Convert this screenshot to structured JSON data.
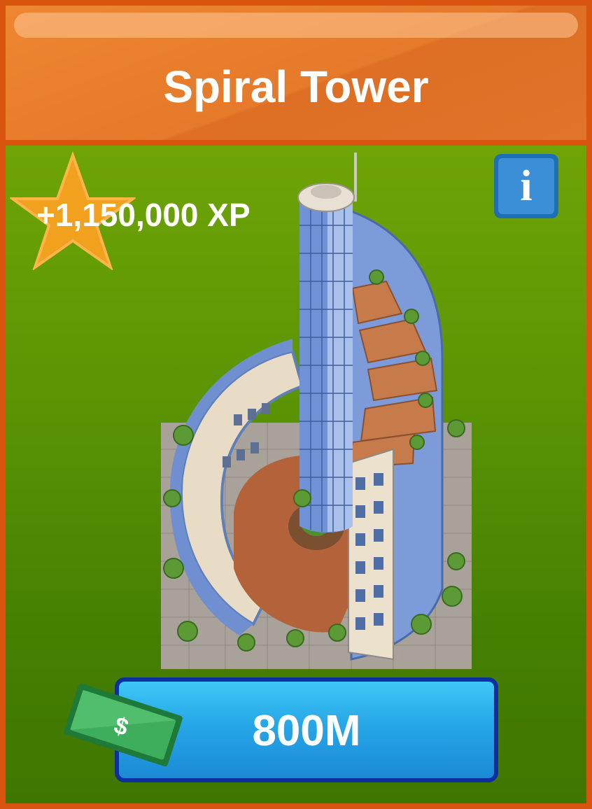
{
  "header": {
    "title": "Spiral Tower"
  },
  "reward": {
    "xp_label": "+1,150,000 XP"
  },
  "info": {
    "glyph": "i"
  },
  "price": {
    "label": "800M",
    "currency_symbol": "$"
  },
  "icons": {
    "star": "star-icon",
    "info": "info-icon",
    "money": "money-bill-icon",
    "building": "spiral-tower-building-image"
  },
  "colors": {
    "header": "#e57a2a",
    "frame": "#d9540f",
    "panel_top": "#6ea406",
    "panel_bottom": "#3f7600",
    "price_button": "#26a6e8",
    "price_border": "#0d2fa0",
    "star": "#f2a11f",
    "bill": "#2c9a4a"
  }
}
